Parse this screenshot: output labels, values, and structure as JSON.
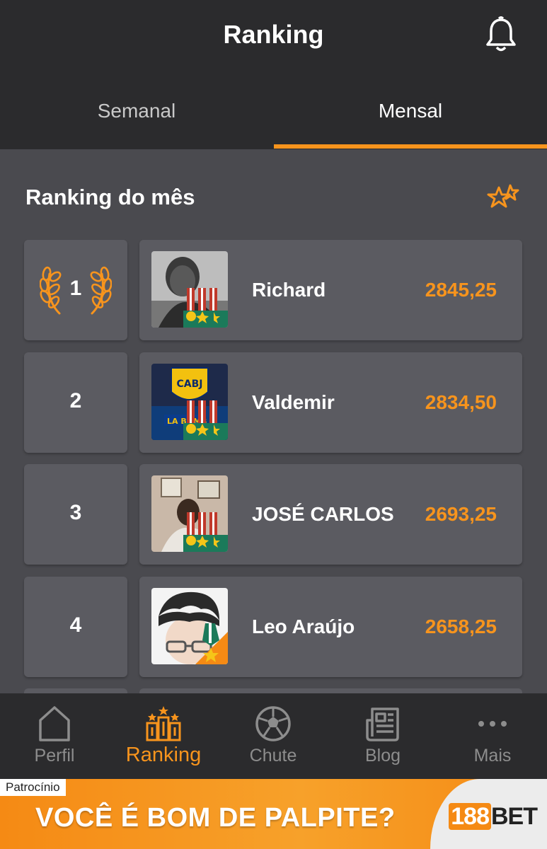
{
  "header": {
    "title": "Ranking"
  },
  "tabs": [
    {
      "label": "Semanal"
    },
    {
      "label": "Mensal"
    }
  ],
  "section": {
    "title": "Ranking do mês"
  },
  "ranking": [
    {
      "position": "1",
      "name": "Richard",
      "score": "2845,25"
    },
    {
      "position": "2",
      "name": "Valdemir",
      "score": "2834,50"
    },
    {
      "position": "3",
      "name": "JOSÉ CARLOS",
      "score": "2693,25"
    },
    {
      "position": "4",
      "name": "Leo Araújo",
      "score": "2658,25"
    }
  ],
  "avatar_badges": {
    "crest_text": "CABJ",
    "sign_text": "LA BOMB"
  },
  "nav": [
    {
      "label": "Perfil",
      "icon": "home-icon"
    },
    {
      "label": "Ranking",
      "icon": "trophy-podium-icon"
    },
    {
      "label": "Chute",
      "icon": "soccer-ball-icon"
    },
    {
      "label": "Blog",
      "icon": "newspaper-icon"
    },
    {
      "label": "Mais",
      "icon": "more-dots-icon"
    }
  ],
  "banner": {
    "tag": "Patrocínio",
    "text": "VOCÊ É BOM DE PALPITE?",
    "brand_number": "188",
    "brand_name": "BET"
  },
  "colors": {
    "accent": "#f7941d",
    "header_bg": "#2b2b2d",
    "card_bg": "#5b5b61",
    "page_bg": "#4a4a4f"
  }
}
